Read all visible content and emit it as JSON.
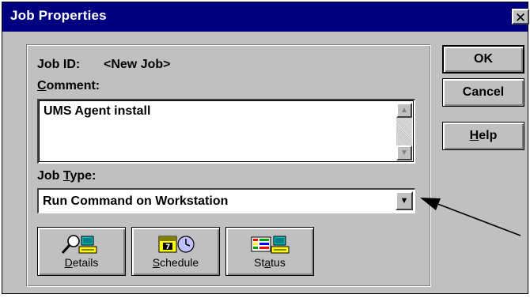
{
  "dialog": {
    "title": "Job Properties",
    "close_glyph": "✕"
  },
  "job": {
    "id_label": "Job ID:",
    "id_value": "<New Job>"
  },
  "comment": {
    "label_accel": "C",
    "label_rest": "omment:",
    "value": "UMS Agent install"
  },
  "job_type": {
    "label_pre": "Job ",
    "label_accel": "T",
    "label_post": "ype:",
    "selected": "Run Command on Workstation"
  },
  "bottom_buttons": {
    "details": {
      "accel": "D",
      "rest": "etails",
      "icon": "magnifier-agent-icon"
    },
    "schedule": {
      "accel": "S",
      "rest": "chedule",
      "icon": "calendar-clock-icon"
    },
    "status": {
      "pre": "St",
      "accel": "a",
      "post": "tus",
      "icon": "status-grid-icon"
    }
  },
  "side_buttons": {
    "ok": "OK",
    "cancel": "Cancel",
    "help_accel": "H",
    "help_rest": "elp"
  },
  "colors": {
    "titlebar": "#000080",
    "face": "#c0c0c0"
  }
}
